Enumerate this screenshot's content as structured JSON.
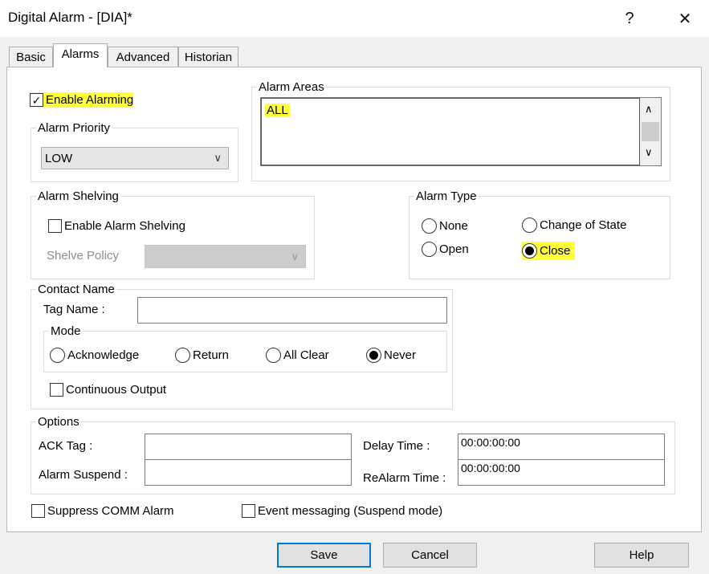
{
  "window": {
    "title": "Digital Alarm - [DIA]*",
    "help_glyph": "?",
    "close_glyph": "✕"
  },
  "tabs": [
    {
      "label": "Basic"
    },
    {
      "label": "Alarms"
    },
    {
      "label": "Advanced"
    },
    {
      "label": "Historian"
    }
  ],
  "enable_alarming": {
    "label": "Enable Alarming",
    "checked": true,
    "check_glyph": "✓"
  },
  "alarm_priority": {
    "legend": "Alarm Priority",
    "value": "LOW"
  },
  "alarm_areas": {
    "legend": "Alarm Areas",
    "value": "ALL"
  },
  "alarm_shelving": {
    "legend": "Alarm Shelving",
    "enable_label": "Enable Alarm Shelving",
    "policy_label": "Shelve Policy"
  },
  "alarm_type": {
    "legend": "Alarm Type",
    "options": {
      "none": "None",
      "change_of_state": "Change of State",
      "open": "Open",
      "close": "Close"
    },
    "selected": "Close"
  },
  "contact_name": {
    "legend": "Contact Name",
    "tag_label": "Tag Name :",
    "tag_value": "",
    "mode": {
      "legend": "Mode",
      "options": {
        "acknowledge": "Acknowledge",
        "return": "Return",
        "all_clear": "All Clear",
        "never": "Never"
      },
      "selected": "Never"
    },
    "continuous_output": "Continuous Output"
  },
  "options": {
    "legend": "Options",
    "ack_tag_label": "ACK Tag :",
    "alarm_suspend_label": "Alarm Suspend :",
    "delay_time_label": "Delay Time :",
    "delay_time_value": "00:00:00:00",
    "realarm_time_label": "ReAlarm Time :",
    "realarm_time_value": "00:00:00:00"
  },
  "suppress_comm": "Suppress COMM Alarm",
  "event_messaging": "Event messaging (Suspend mode)",
  "buttons": {
    "save": "Save",
    "cancel": "Cancel",
    "help": "Help"
  },
  "colors": {
    "highlight": "#ffff3c",
    "default_button_border": "#0078d7"
  }
}
